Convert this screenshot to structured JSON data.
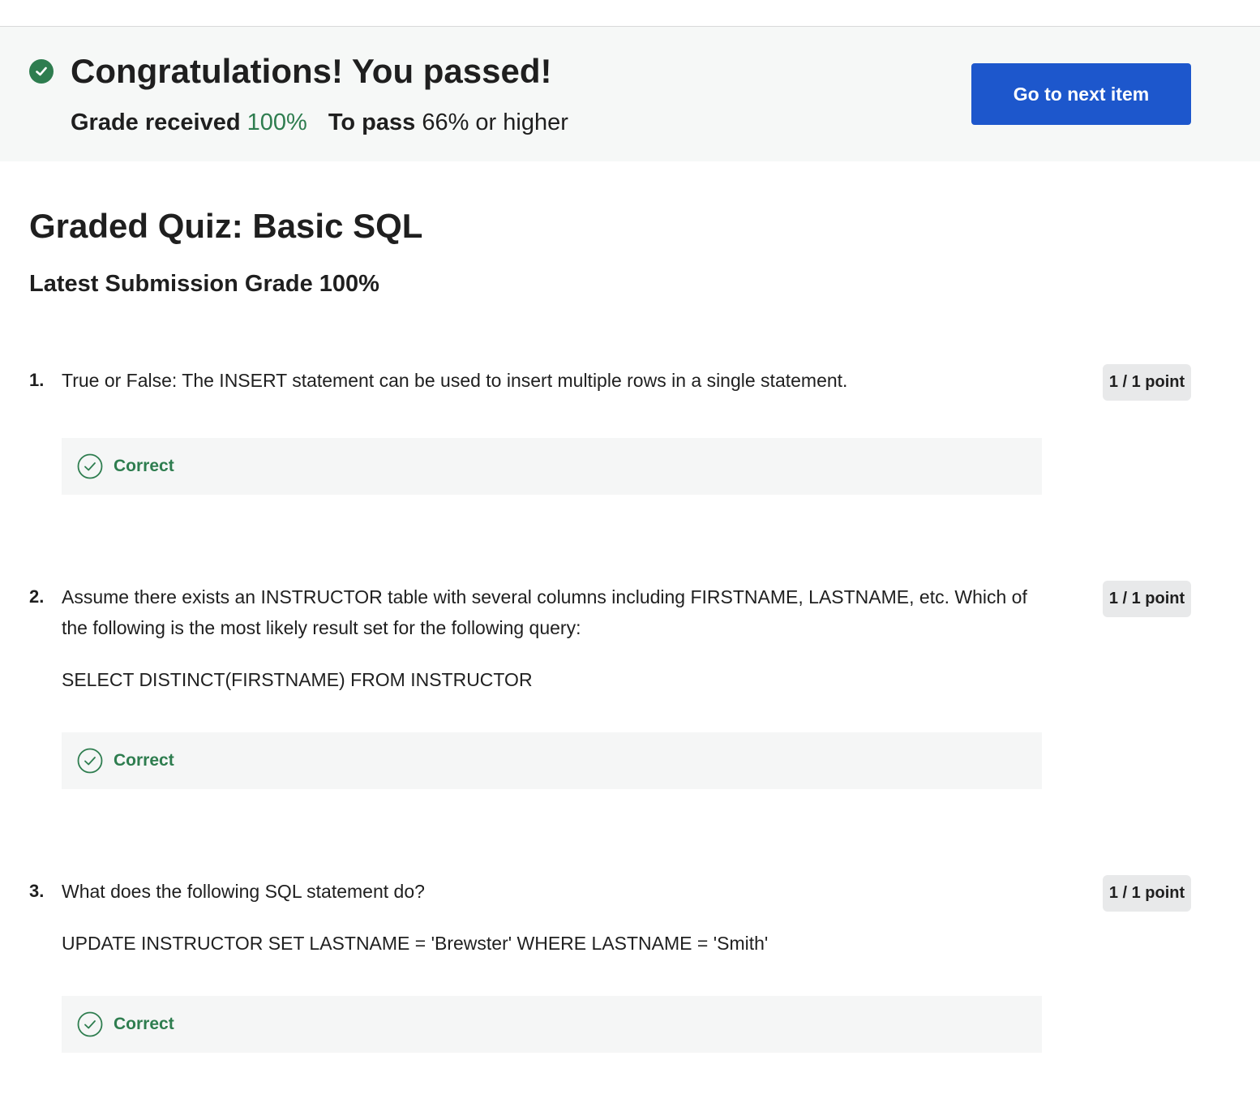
{
  "banner": {
    "title": "Congratulations! You passed!",
    "grade_received_label": "Grade received",
    "grade_received_value": "100%",
    "to_pass_label": "To pass",
    "to_pass_value": "66% or higher",
    "next_button_label": "Go to next item",
    "success_color": "#2e7d4f",
    "button_color": "#1d57cc"
  },
  "quiz": {
    "title": "Graded Quiz: Basic SQL",
    "latest_grade": "Latest Submission Grade 100%"
  },
  "questions": [
    {
      "number": "1.",
      "text": "True or False: The INSERT statement can be used to insert multiple rows in a single statement.",
      "code": "",
      "points": "1 / 1 point",
      "feedback": "Correct"
    },
    {
      "number": "2.",
      "text": "Assume there exists an INSTRUCTOR table with several columns including FIRSTNAME, LASTNAME, etc. Which of the following is the most likely result set for the following query:",
      "code": "SELECT DISTINCT(FIRSTNAME) FROM INSTRUCTOR",
      "points": "1 / 1 point",
      "feedback": "Correct"
    },
    {
      "number": "3.",
      "text": "What does the following SQL statement do?",
      "code": "UPDATE INSTRUCTOR SET LASTNAME = 'Brewster' WHERE LASTNAME = 'Smith'",
      "points": "1 / 1 point",
      "feedback": "Correct"
    }
  ]
}
